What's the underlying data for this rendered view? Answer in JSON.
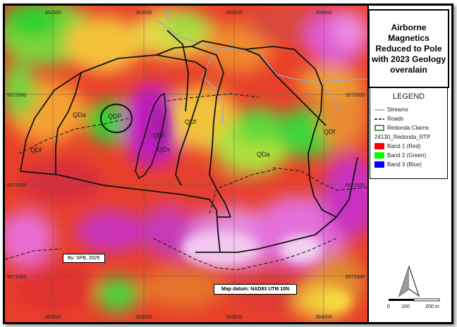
{
  "title": "Airborne Magnetics Reduced to Pole with 2023 Geology overalain",
  "legend": {
    "heading": "LEGEND",
    "items": [
      {
        "label": "Streams",
        "color": "#8aa8d6"
      },
      {
        "label": "Roads",
        "color": "#000000"
      },
      {
        "label": "Redonda Claims",
        "color": "#2e7d32"
      }
    ],
    "raster_layer": "24130_Redonda_RTP",
    "bands": [
      {
        "label": "Band 1 (Red)",
        "color": "#ff0000"
      },
      {
        "label": "Band 2 (Green)",
        "color": "#00ff00"
      },
      {
        "label": "Band 3 (Blue)",
        "color": "#0000ff"
      }
    ]
  },
  "coords": {
    "top": [
      "362500",
      "363000",
      "363500",
      "364000"
    ],
    "bottom": [
      "362500",
      "363000",
      "363500",
      "364000"
    ],
    "left": [
      "5572000",
      "5571500",
      "5571000"
    ],
    "right": [
      "5572000",
      "5571500",
      "5571000"
    ]
  },
  "geology_labels": [
    "QDa",
    "QDf",
    "QDf",
    "QDa",
    "QDf",
    "QDf",
    "QDx",
    "QDf"
  ],
  "credit": "By: SPB, 2025",
  "datum": "Map datum: NAD83 UTM 10N",
  "scale": {
    "ticks": [
      "0",
      "100",
      "200 m"
    ]
  },
  "north_icon": "north-arrow-icon"
}
